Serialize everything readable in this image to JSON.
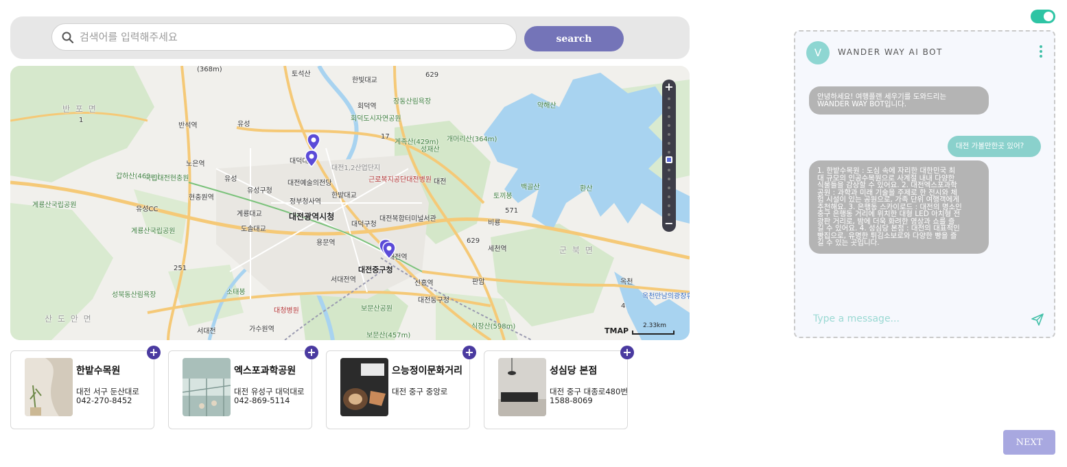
{
  "search": {
    "placeholder": "검색어를 입력해주세요",
    "button_label": "search"
  },
  "map": {
    "labels": {
      "l1": "(368m)",
      "l2": "토석산",
      "l3": "한빛대교",
      "l4": "629",
      "l5": "장동산림욕장",
      "l6": "반 포 면",
      "l7": "회덕역",
      "l8": "약해산",
      "l9": "회덕도시자연공원",
      "l10": "반석역",
      "l11": "유성",
      "l12": "계족산(429m)",
      "l13": "성재산",
      "l14": "개머리산(364m)",
      "l15": "갑하산(469m)",
      "l16": "국립대전현충원",
      "l17": "노은역",
      "l18": "대덕대교",
      "l19": "대전1,2산업단지",
      "l20": "대전",
      "l21": "유성",
      "l22": "유성구청",
      "l23": "대전예술의전당",
      "l24": "근로복지공단대전병원",
      "l25": "계룡산국립공원",
      "l26": "현충원역",
      "l27": "정부청사역",
      "l28": "한밭대교",
      "l29": "백골산",
      "l30": "환산",
      "l31": "유성CC",
      "l32": "계룡대교",
      "l33": "대전광역시청",
      "l34": "대덕구청",
      "l35": "대전복합터미널서관",
      "l36": "토끼봉",
      "l37": "비룡",
      "l38": "571",
      "l39": "계룡산국립공원",
      "l40": "도솔대교",
      "l41": "용문역",
      "l42": "세천역",
      "l43": "629",
      "l44": "군 북 면",
      "l45": "대전역",
      "l46": "251",
      "l47": "서대전역",
      "l48": "대전중구청",
      "l49": "신흥역",
      "l50": "판암",
      "l51": "옥천",
      "l52": "성북동산림욕장",
      "l53": "소태봉",
      "l54": "대청병원",
      "l55": "보문산공원",
      "l56": "대전동구청",
      "l57": "옥천만남의광장휴게소",
      "l58": "산 도 안 면",
      "l59": "가수원역",
      "l60": "식장산(598m)",
      "l61": "서대전",
      "l62": "보문산(457m)",
      "l63": "4",
      "l64": "17",
      "l65": "1"
    },
    "scale_label": "2.33km",
    "brand": "TMAP"
  },
  "places": [
    {
      "name": "한밭수목원",
      "address": "대전 서구 둔산대로",
      "phone": "042-270-8452"
    },
    {
      "name": "엑스포과학공원",
      "address": "대전 유성구 대덕대로",
      "phone": "042-869-5114"
    },
    {
      "name": "으능정이문화거리",
      "address": "대전 중구 중앙로",
      "phone": ""
    },
    {
      "name": "성심당 본점",
      "address": "대전 중구 대종로480번",
      "phone": "1588-8069"
    }
  ],
  "chat": {
    "avatar_letter": "V",
    "title": "WANDER WAY AI BOT",
    "messages": [
      {
        "from": "bot",
        "lines": [
          "안녕하세요! 여행플랜 세우기를 도와드리는",
          "WANDER WAY BOT입니다."
        ]
      },
      {
        "from": "user",
        "lines": [
          "대전 가볼만한곳 있어?"
        ]
      },
      {
        "from": "bot",
        "lines": [
          "1. 한밭수목원 : 도심 속에 자리한 대한민국 최",
          "대 규모의 인공수목원으로 사계절 내내 다양한",
          "식물들을 감상할 수 있어요. 2. 대전엑스포과학",
          "공원 : 과학과 미래 기술을 주제로 한 전시와 체",
          "험 시설이 있는 공원으로, 가족 단위 여행객에게",
          "추천해요. 3. 은행동 스카이로드 : 대전의 명소인",
          "중구 은행동 거리에 위치한 대형 LED 아치형 전",
          "광판 거리로, 밤에 더욱 화려한 영상과 쇼를 즐",
          "길 수 있어요. 4. 성심당 본점 : 대전의 대표적인",
          "빵집으로, 유명한 튀김소보로와 다양한 빵을 즐",
          "길 수 있는 곳입니다."
        ]
      }
    ],
    "input_placeholder": "Type a message..."
  },
  "next_label": "NEXT",
  "colors": {
    "accent": "#7474b8",
    "teal": "#2ec4a4",
    "pin": "#5b4bd8"
  }
}
